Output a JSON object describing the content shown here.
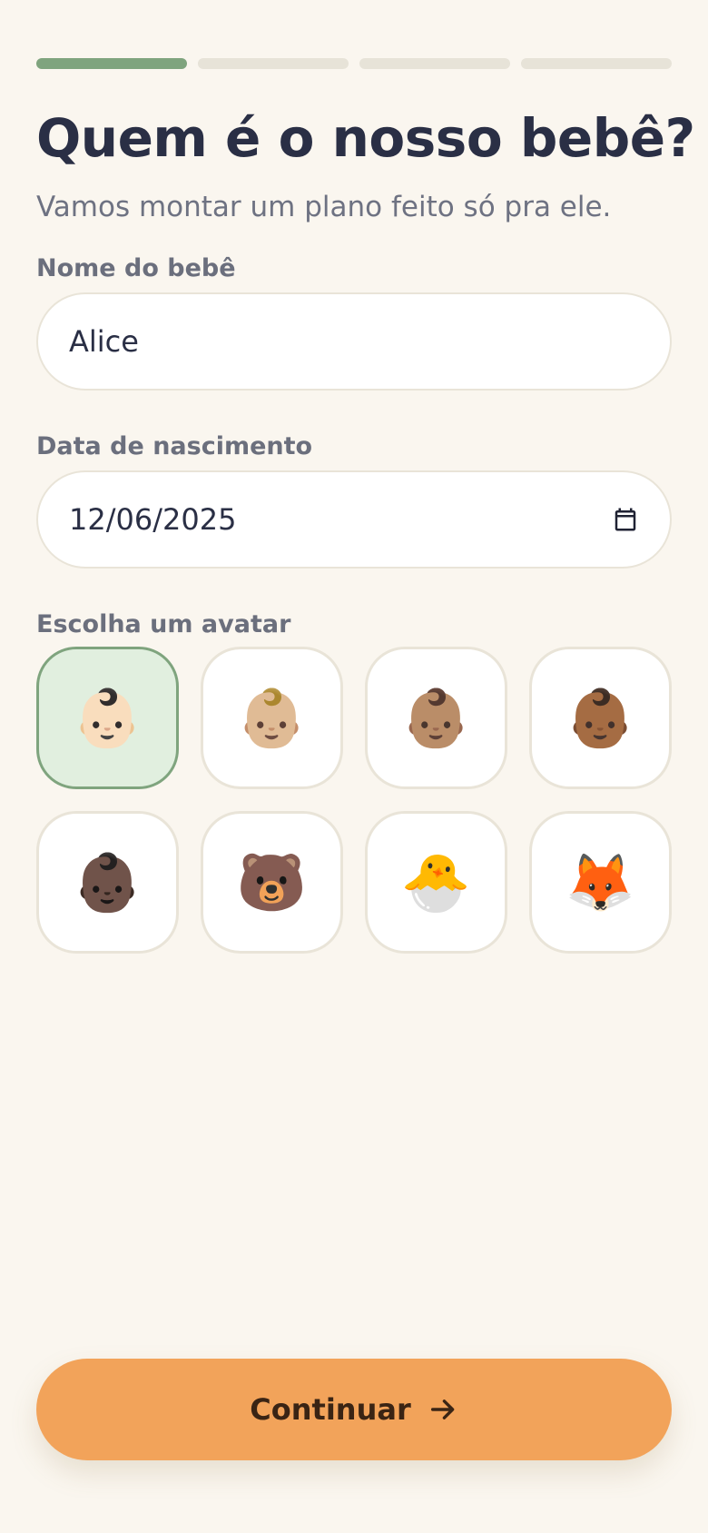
{
  "progress": {
    "total_steps": 4,
    "current_step": 1
  },
  "header": {
    "title": "Quem é o nosso bebê?",
    "subtitle": "Vamos montar um plano feito só pra ele."
  },
  "form": {
    "name_label": "Nome do bebê",
    "name_value": "Alice",
    "birth_label": "Data de nascimento",
    "birth_value": "12/06/2025",
    "avatar_label": "Escolha um avatar"
  },
  "avatars": {
    "selected_index": 0,
    "options": [
      "👶🏻",
      "👶🏼",
      "👶🏽",
      "👶🏾",
      "👶🏿",
      "🐻",
      "🐣",
      "🦊"
    ],
    "selected_color": "#e1efdf",
    "selected_border_color": "#7fa47e"
  },
  "icons": {
    "date_picker": "calendar-icon",
    "continue": "arrow-right-icon"
  },
  "cta": {
    "label": "Continuar",
    "color": "#f2a35a"
  },
  "colors": {
    "background": "#faf6ef",
    "progress_active": "#7fa47e",
    "progress_inactive": "#e7e3d8",
    "title": "#2a2f45"
  }
}
